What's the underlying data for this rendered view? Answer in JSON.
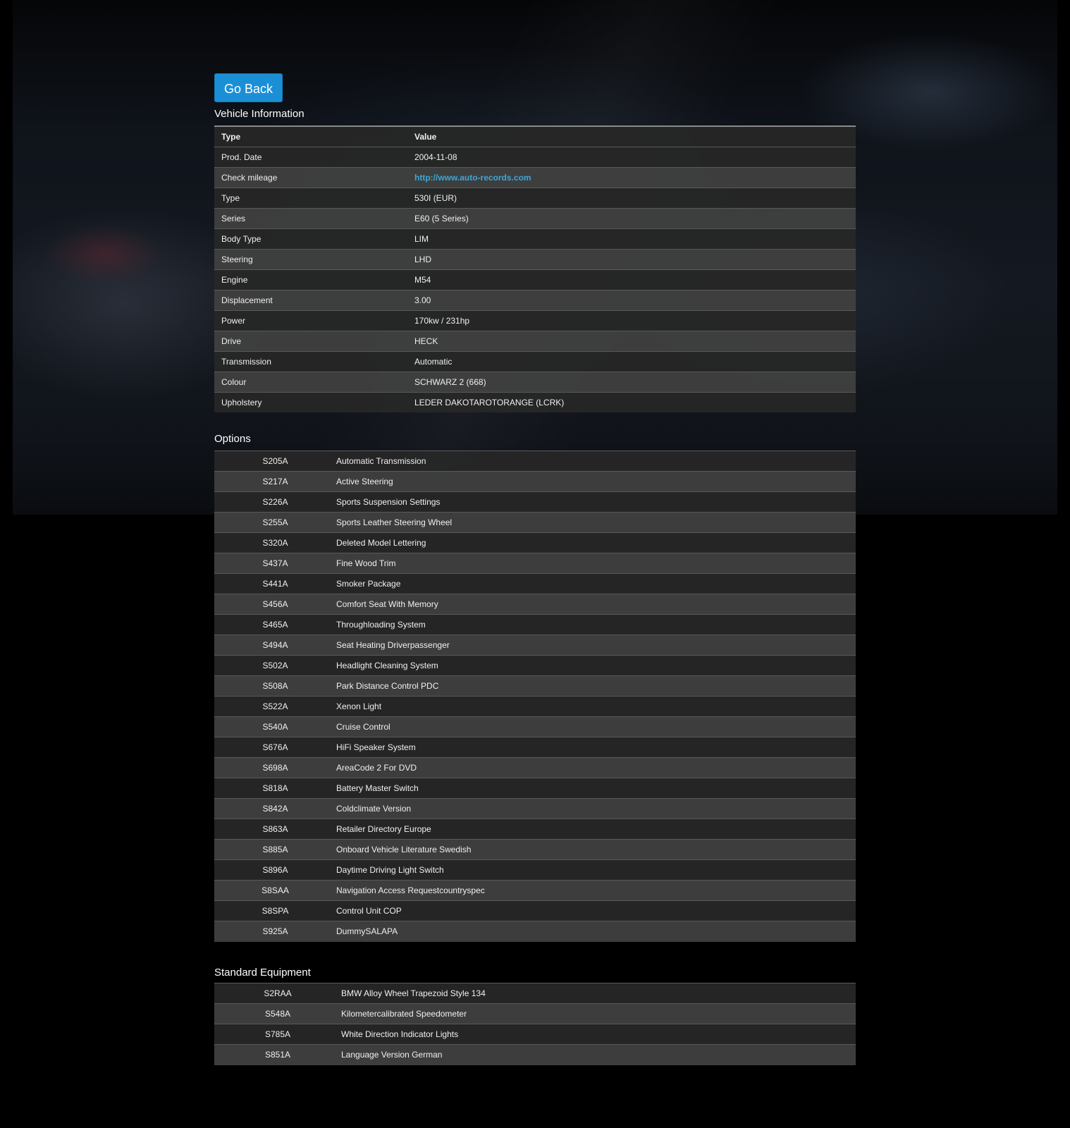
{
  "actions": {
    "back_label": "Go Back"
  },
  "vehicle": {
    "title": "Vehicle Information",
    "header": {
      "type": "Type",
      "value": "Value"
    },
    "rows": [
      {
        "label": "Prod. Date",
        "value": "2004-11-08"
      },
      {
        "label": "Check mileage",
        "value": "http://www.auto-records.com"
      },
      {
        "label": "Type",
        "value": "530I (EUR)"
      },
      {
        "label": "Series",
        "value": "E60 (5 Series)"
      },
      {
        "label": "Body Type",
        "value": "LIM"
      },
      {
        "label": "Steering",
        "value": "LHD"
      },
      {
        "label": "Engine",
        "value": "M54"
      },
      {
        "label": "Displacement",
        "value": "3.00"
      },
      {
        "label": "Power",
        "value": "170kw / 231hp"
      },
      {
        "label": "Drive",
        "value": "HECK"
      },
      {
        "label": "Transmission",
        "value": "Automatic"
      },
      {
        "label": "Colour",
        "value": "SCHWARZ 2 (668)"
      },
      {
        "label": "Upholstery",
        "value": "LEDER DAKOTAROTORANGE (LCRK)"
      }
    ]
  },
  "options": {
    "title": "Options",
    "rows": [
      {
        "code": "S205A",
        "desc": "Automatic Transmission"
      },
      {
        "code": "S217A",
        "desc": "Active Steering"
      },
      {
        "code": "S226A",
        "desc": "Sports Suspension Settings"
      },
      {
        "code": "S255A",
        "desc": "Sports Leather Steering Wheel"
      },
      {
        "code": "S320A",
        "desc": "Deleted Model Lettering"
      },
      {
        "code": "S437A",
        "desc": "Fine Wood Trim"
      },
      {
        "code": "S441A",
        "desc": "Smoker Package"
      },
      {
        "code": "S456A",
        "desc": "Comfort Seat With Memory"
      },
      {
        "code": "S465A",
        "desc": "Throughloading System"
      },
      {
        "code": "S494A",
        "desc": "Seat Heating Driverpassenger"
      },
      {
        "code": "S502A",
        "desc": "Headlight Cleaning System"
      },
      {
        "code": "S508A",
        "desc": "Park Distance Control PDC"
      },
      {
        "code": "S522A",
        "desc": "Xenon Light"
      },
      {
        "code": "S540A",
        "desc": "Cruise Control"
      },
      {
        "code": "S676A",
        "desc": "HiFi Speaker System"
      },
      {
        "code": "S698A",
        "desc": "AreaCode 2 For DVD"
      },
      {
        "code": "S818A",
        "desc": "Battery Master Switch"
      },
      {
        "code": "S842A",
        "desc": "Coldclimate Version"
      },
      {
        "code": "S863A",
        "desc": "Retailer Directory Europe"
      },
      {
        "code": "S885A",
        "desc": "Onboard Vehicle Literature Swedish"
      },
      {
        "code": "S896A",
        "desc": "Daytime Driving Light Switch"
      },
      {
        "code": "S8SAA",
        "desc": "Navigation Access Requestcountryspec"
      },
      {
        "code": "S8SPA",
        "desc": "Control Unit COP"
      },
      {
        "code": "S925A",
        "desc": "DummySALAPA"
      }
    ]
  },
  "standard": {
    "title": "Standard Equipment",
    "rows": [
      {
        "code": "S2RAA",
        "desc": "BMW Alloy Wheel Trapezoid Style 134"
      },
      {
        "code": "S548A",
        "desc": "Kilometercalibrated Speedometer"
      },
      {
        "code": "S785A",
        "desc": "White Direction Indicator Lights"
      },
      {
        "code": "S851A",
        "desc": "Language Version German"
      }
    ]
  }
}
